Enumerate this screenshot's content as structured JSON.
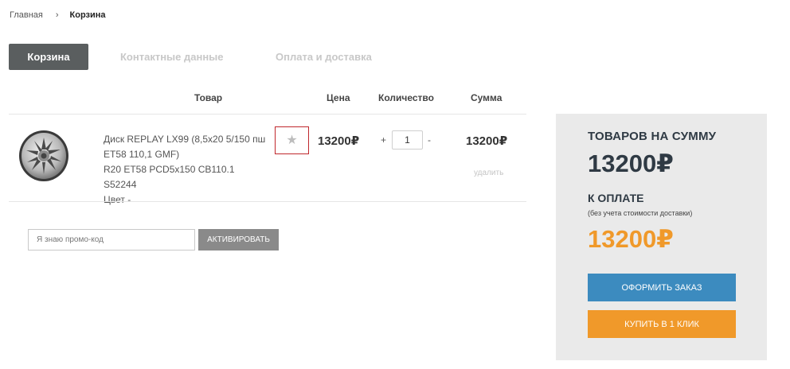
{
  "breadcrumb": {
    "home": "Главная",
    "separator": "›",
    "current": "Корзина"
  },
  "steps": [
    "Корзина",
    "Контактные данные",
    "Оплата и доставка"
  ],
  "table": {
    "headers": {
      "product": "Товар",
      "price": "Цена",
      "quantity": "Количество",
      "sum": "Сумма"
    }
  },
  "item": {
    "image_icon": "wheel-rim-icon",
    "desc_lines": [
      "Диск REPLAY LX99 (8,5x20 5/150 пш",
      "ET58 110,1 GMF)",
      "R20 ET58 PCD5x150 CB110.1 S52244",
      "Цвет -"
    ],
    "favorite_icon": "star-icon",
    "price": "13200₽",
    "qty_plus": "+",
    "quantity": "1",
    "qty_minus": "-",
    "sum": "13200₽",
    "delete": "удалить"
  },
  "promo": {
    "placeholder": "Я знаю промо-код",
    "button": "АКТИВИРОВАТЬ"
  },
  "summary": {
    "total_label": "ТОВАРОВ НА СУММУ",
    "total": "13200₽",
    "pay_label": "К ОПЛАТЕ",
    "pay_note": "(без учета стоимости доставки)",
    "pay_total": "13200₽",
    "checkout": "ОФОРМИТЬ ЗАКАЗ",
    "one_click": "КУПИТЬ В 1 КЛИК"
  },
  "colors": {
    "active_step": "#5a5e5f",
    "checkout_button": "#3c8bbf",
    "one_click_button": "#f0992a",
    "pay_total": "#f0992a",
    "favorite_border": "#c0282d"
  }
}
